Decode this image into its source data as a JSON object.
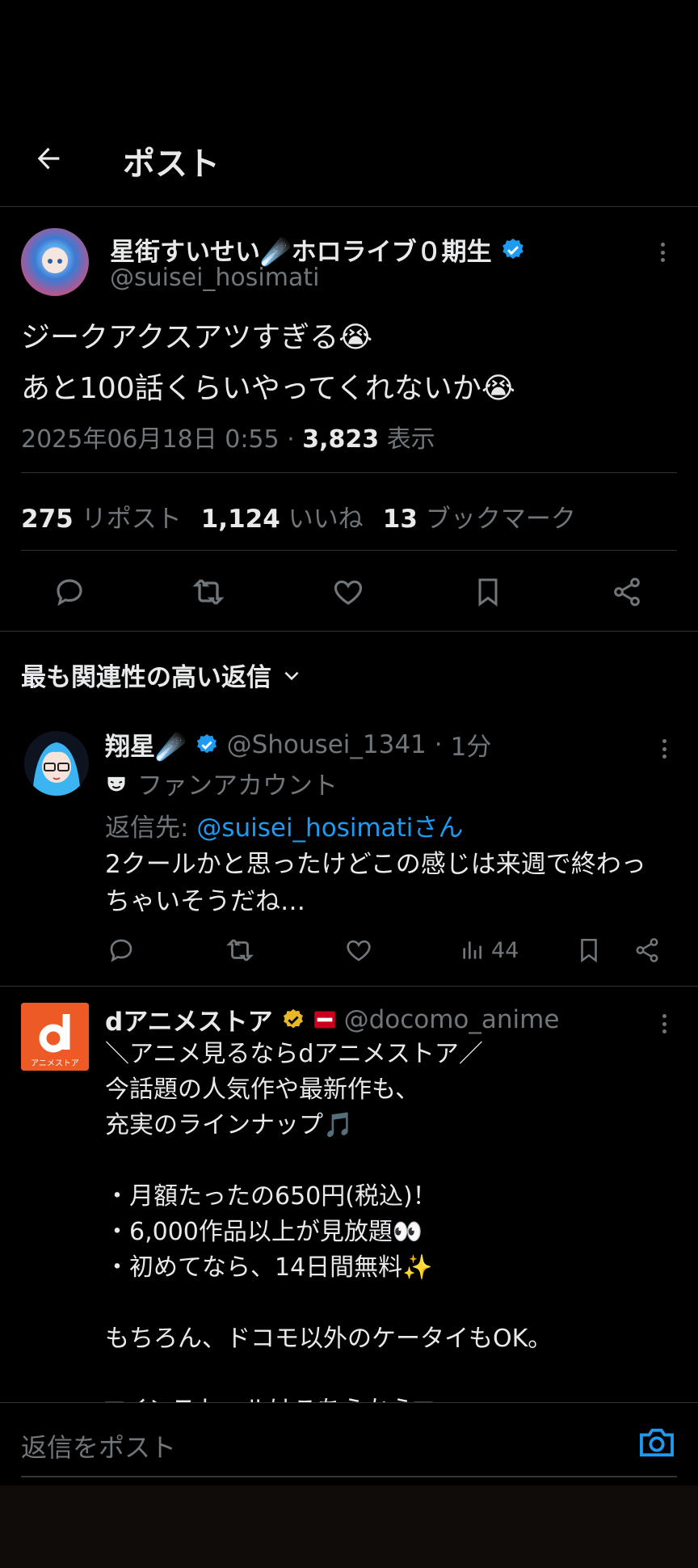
{
  "header": {
    "title": "ポスト"
  },
  "post": {
    "author_name": "星街すいせい☄️ホロライブ０期生",
    "handle": "@suisei_hosimati",
    "lines": [
      "ジークアクスアツすぎる😭",
      "あと100話くらいやってくれないか😭"
    ],
    "timestamp": "2025年06月18日 0:55",
    "views_count": "3,823",
    "views_label": "表示",
    "reposts_count": "275",
    "reposts_label": "リポスト",
    "likes_count": "1,124",
    "likes_label": "いいね",
    "bookmarks_count": "13",
    "bookmarks_label": "ブックマーク"
  },
  "replies_sort": {
    "label": "最も関連性の高い返信"
  },
  "reply": {
    "name": "翔星☄️",
    "handle": "@Shousei_1341",
    "time": "1分",
    "fan_label": "ファンアカウント",
    "reply_to_prefix": "返信先: ",
    "reply_to_handle": "@suisei_hosimatiさん",
    "text": "2クールかと思ったけどこの感じは来週で終わっちゃいそうだね…",
    "views": "44"
  },
  "ad": {
    "name": "dアニメストア",
    "handle": "@docomo_anime",
    "logo_text": "アニメストア",
    "text": "＼アニメ見るならdアニメストア／\n 今話題の人気作や最新作も、\n 充実のラインナップ🎵\n\n・月額たったの650円(税込)！\n・6,000作品以上が見放題👀\n・初めてなら、14日間無料✨\n\n もちろん、ドコモ以外のケータイもOK。\n\n▼インストールはこちらから▼"
  },
  "compose": {
    "placeholder": "返信をポスト"
  },
  "colors": {
    "accent": "#1d9bf0",
    "gold": "#e8b829",
    "muted": "#71767b",
    "ad_orange": "#ee5a26"
  }
}
